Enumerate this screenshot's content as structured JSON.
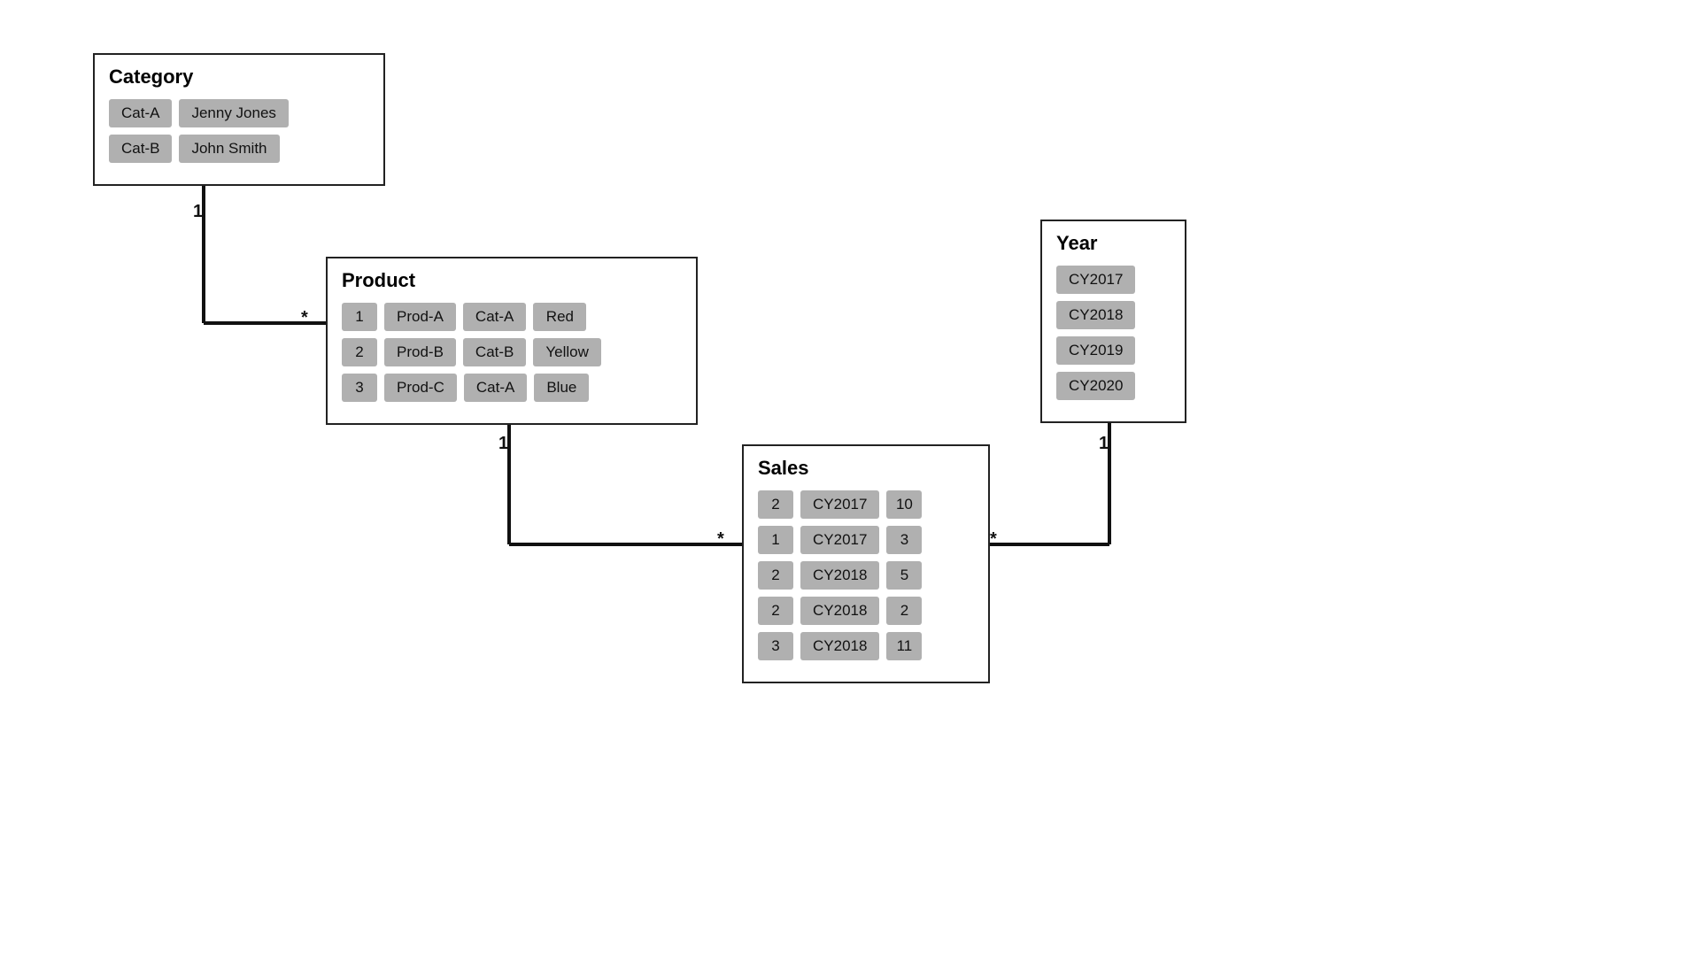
{
  "category": {
    "title": "Category",
    "rows": [
      [
        "Cat-A",
        "Jenny Jones"
      ],
      [
        "Cat-B",
        "John Smith"
      ]
    ]
  },
  "product": {
    "title": "Product",
    "rows": [
      [
        "1",
        "Prod-A",
        "Cat-A",
        "Red"
      ],
      [
        "2",
        "Prod-B",
        "Cat-B",
        "Yellow"
      ],
      [
        "3",
        "Prod-C",
        "Cat-A",
        "Blue"
      ]
    ]
  },
  "year": {
    "title": "Year",
    "rows": [
      [
        "CY2017"
      ],
      [
        "CY2018"
      ],
      [
        "CY2019"
      ],
      [
        "CY2020"
      ]
    ]
  },
  "sales": {
    "title": "Sales",
    "rows": [
      [
        "2",
        "CY2017",
        "10"
      ],
      [
        "1",
        "CY2017",
        "3"
      ],
      [
        "2",
        "CY2018",
        "5"
      ],
      [
        "2",
        "CY2018",
        "2"
      ],
      [
        "3",
        "CY2018",
        "11"
      ]
    ]
  },
  "relationships": {
    "cat_to_prod": {
      "from": "1",
      "to": "*"
    },
    "prod_to_sales": {
      "from": "1",
      "to": "*"
    },
    "year_to_sales": {
      "from": "1",
      "to": "*"
    }
  }
}
